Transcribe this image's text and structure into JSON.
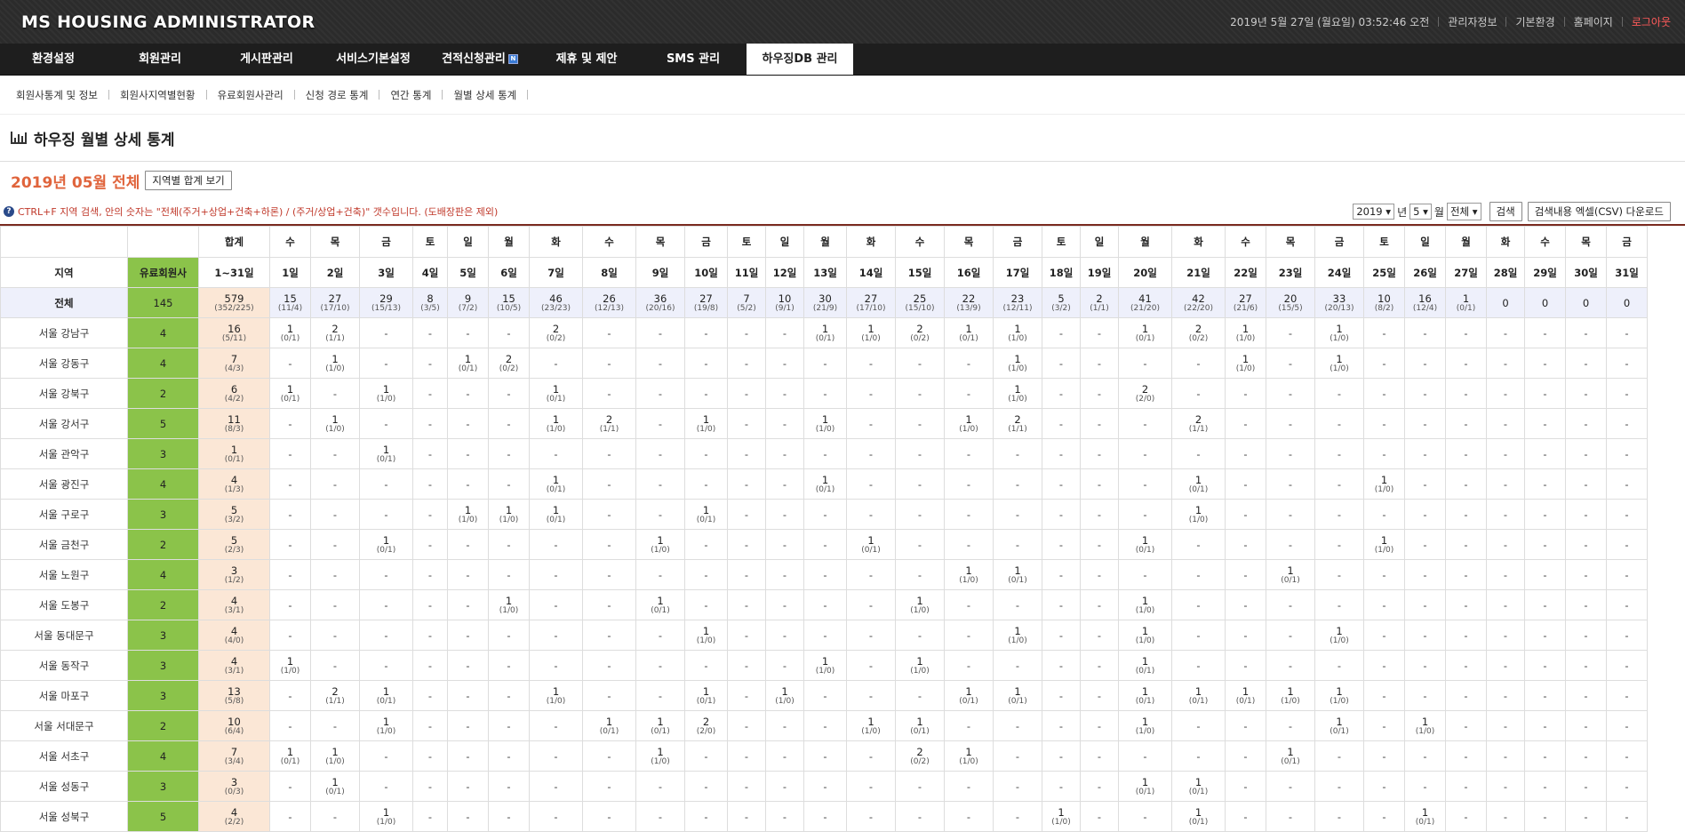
{
  "header": {
    "title": "MS HOUSING ADMINISTRATOR",
    "datetime": "2019년 5월 27일 (월요일) 03:52:46 오전",
    "links": [
      "관리자정보",
      "기본환경",
      "홈페이지",
      "로그아웃"
    ]
  },
  "nav": [
    "환경설정",
    "회원관리",
    "게시판관리",
    "서비스기본설정",
    "견적신청관리",
    "제휴 및 제안",
    "SMS 관리",
    "하우징DB 관리"
  ],
  "nav_badge": "N",
  "subnav": [
    "회원사통계 및 정보",
    "회원사지역별현황",
    "유료회원사관리",
    "신청 경로 통계",
    "연간 통계",
    "월별 상세 통계"
  ],
  "page_title": "하우징 월별 상세 통계",
  "period": {
    "title": "2019년 05월 전체",
    "region_sum_button": "지역별 합계 보기"
  },
  "note": "CTRL+F 지역 검색, 안의 숫자는 \"전체(주거+상업+건축+하론) / (주거/상업+건축)\" 갯수입니다. (도배장판은 제외)",
  "controls": {
    "year": "2019",
    "year_suffix": "년",
    "month": "5",
    "month_suffix": "월",
    "type": "전체",
    "search_button": "검색",
    "csv_button": "검색내용 엑셀(CSV) 다운로드"
  },
  "table": {
    "head_sum_dow": "합계",
    "head_region": "지역",
    "head_members": "유료회원사",
    "head_sum_range": "1~31일",
    "dow": [
      "수",
      "목",
      "금",
      "토",
      "일",
      "월",
      "화",
      "수",
      "목",
      "금",
      "토",
      "일",
      "월",
      "화",
      "수",
      "목",
      "금",
      "토",
      "일",
      "월",
      "화",
      "수",
      "목",
      "금",
      "토",
      "일",
      "월",
      "화",
      "수",
      "목",
      "금"
    ],
    "days": [
      "1일",
      "2일",
      "3일",
      "4일",
      "5일",
      "6일",
      "7일",
      "8일",
      "9일",
      "10일",
      "11일",
      "12일",
      "13일",
      "14일",
      "15일",
      "16일",
      "17일",
      "18일",
      "19일",
      "20일",
      "21일",
      "22일",
      "23일",
      "24일",
      "25일",
      "26일",
      "27일",
      "28일",
      "29일",
      "30일",
      "31일"
    ],
    "total": {
      "region": "전체",
      "members": "145",
      "sum_v": "579",
      "sum_s": "(352/225)",
      "cells": [
        [
          "15",
          "(11/4)"
        ],
        [
          "27",
          "(17/10)"
        ],
        [
          "29",
          "(15/13)"
        ],
        [
          "8",
          "(3/5)"
        ],
        [
          "9",
          "(7/2)"
        ],
        [
          "15",
          "(10/5)"
        ],
        [
          "46",
          "(23/23)"
        ],
        [
          "26",
          "(12/13)"
        ],
        [
          "36",
          "(20/16)"
        ],
        [
          "27",
          "(19/8)"
        ],
        [
          "7",
          "(5/2)"
        ],
        [
          "10",
          "(9/1)"
        ],
        [
          "30",
          "(21/9)"
        ],
        [
          "27",
          "(17/10)"
        ],
        [
          "25",
          "(15/10)"
        ],
        [
          "22",
          "(13/9)"
        ],
        [
          "23",
          "(12/11)"
        ],
        [
          "5",
          "(3/2)"
        ],
        [
          "2",
          "(1/1)"
        ],
        [
          "41",
          "(21/20)"
        ],
        [
          "42",
          "(22/20)"
        ],
        [
          "27",
          "(21/6)"
        ],
        [
          "20",
          "(15/5)"
        ],
        [
          "33",
          "(20/13)"
        ],
        [
          "10",
          "(8/2)"
        ],
        [
          "16",
          "(12/4)"
        ],
        [
          "1",
          "(0/1)"
        ],
        [
          "0",
          ""
        ],
        [
          "0",
          ""
        ],
        [
          "0",
          ""
        ],
        [
          "0",
          ""
        ]
      ]
    },
    "rows": [
      {
        "region": "서울 강남구",
        "members": "4",
        "sum_v": "16",
        "sum_s": "(5/11)",
        "cells": {
          "0": [
            "1",
            "(0/1)"
          ],
          "1": [
            "2",
            "(1/1)"
          ],
          "6": [
            "2",
            "(0/2)"
          ],
          "12": [
            "1",
            "(0/1)"
          ],
          "13": [
            "1",
            "(1/0)"
          ],
          "14": [
            "2",
            "(0/2)"
          ],
          "15": [
            "1",
            "(0/1)"
          ],
          "16": [
            "1",
            "(1/0)"
          ],
          "19": [
            "1",
            "(0/1)"
          ],
          "20": [
            "2",
            "(0/2)"
          ],
          "21": [
            "1",
            "(1/0)"
          ],
          "23": [
            "1",
            "(1/0)"
          ]
        }
      },
      {
        "region": "서울 강동구",
        "members": "4",
        "sum_v": "7",
        "sum_s": "(4/3)",
        "cells": {
          "1": [
            "1",
            "(1/0)"
          ],
          "4": [
            "1",
            "(0/1)"
          ],
          "5": [
            "2",
            "(0/2)"
          ],
          "16": [
            "1",
            "(1/0)"
          ],
          "21": [
            "1",
            "(1/0)"
          ],
          "23": [
            "1",
            "(1/0)"
          ]
        }
      },
      {
        "region": "서울 강북구",
        "members": "2",
        "sum_v": "6",
        "sum_s": "(4/2)",
        "cells": {
          "0": [
            "1",
            "(0/1)"
          ],
          "2": [
            "1",
            "(1/0)"
          ],
          "6": [
            "1",
            "(0/1)"
          ],
          "16": [
            "1",
            "(1/0)"
          ],
          "19": [
            "2",
            "(2/0)"
          ]
        }
      },
      {
        "region": "서울 강서구",
        "members": "5",
        "sum_v": "11",
        "sum_s": "(8/3)",
        "cells": {
          "1": [
            "1",
            "(1/0)"
          ],
          "6": [
            "1",
            "(1/0)"
          ],
          "7": [
            "2",
            "(1/1)"
          ],
          "9": [
            "1",
            "(1/0)"
          ],
          "12": [
            "1",
            "(1/0)"
          ],
          "15": [
            "1",
            "(1/0)"
          ],
          "16": [
            "2",
            "(1/1)"
          ],
          "20": [
            "2",
            "(1/1)"
          ]
        }
      },
      {
        "region": "서울 관악구",
        "members": "3",
        "sum_v": "1",
        "sum_s": "(0/1)",
        "cells": {
          "2": [
            "1",
            "(0/1)"
          ]
        }
      },
      {
        "region": "서울 광진구",
        "members": "4",
        "sum_v": "4",
        "sum_s": "(1/3)",
        "cells": {
          "6": [
            "1",
            "(0/1)"
          ],
          "12": [
            "1",
            "(0/1)"
          ],
          "20": [
            "1",
            "(0/1)"
          ],
          "24": [
            "1",
            "(1/0)"
          ]
        }
      },
      {
        "region": "서울 구로구",
        "members": "3",
        "sum_v": "5",
        "sum_s": "(3/2)",
        "cells": {
          "4": [
            "1",
            "(1/0)"
          ],
          "5": [
            "1",
            "(1/0)"
          ],
          "6": [
            "1",
            "(0/1)"
          ],
          "9": [
            "1",
            "(0/1)"
          ],
          "20": [
            "1",
            "(1/0)"
          ]
        }
      },
      {
        "region": "서울 금천구",
        "members": "2",
        "sum_v": "5",
        "sum_s": "(2/3)",
        "cells": {
          "2": [
            "1",
            "(0/1)"
          ],
          "8": [
            "1",
            "(1/0)"
          ],
          "13": [
            "1",
            "(0/1)"
          ],
          "19": [
            "1",
            "(0/1)"
          ],
          "24": [
            "1",
            "(1/0)"
          ]
        }
      },
      {
        "region": "서울 노원구",
        "members": "4",
        "sum_v": "3",
        "sum_s": "(1/2)",
        "cells": {
          "15": [
            "1",
            "(1/0)"
          ],
          "16": [
            "1",
            "(0/1)"
          ],
          "22": [
            "1",
            "(0/1)"
          ]
        }
      },
      {
        "region": "서울 도봉구",
        "members": "2",
        "sum_v": "4",
        "sum_s": "(3/1)",
        "cells": {
          "5": [
            "1",
            "(1/0)"
          ],
          "8": [
            "1",
            "(0/1)"
          ],
          "14": [
            "1",
            "(1/0)"
          ],
          "19": [
            "1",
            "(1/0)"
          ]
        }
      },
      {
        "region": "서울 동대문구",
        "members": "3",
        "sum_v": "4",
        "sum_s": "(4/0)",
        "cells": {
          "9": [
            "1",
            "(1/0)"
          ],
          "16": [
            "1",
            "(1/0)"
          ],
          "19": [
            "1",
            "(1/0)"
          ],
          "23": [
            "1",
            "(1/0)"
          ]
        }
      },
      {
        "region": "서울 동작구",
        "members": "3",
        "sum_v": "4",
        "sum_s": "(3/1)",
        "cells": {
          "0": [
            "1",
            "(1/0)"
          ],
          "12": [
            "1",
            "(1/0)"
          ],
          "14": [
            "1",
            "(1/0)"
          ],
          "19": [
            "1",
            "(0/1)"
          ]
        }
      },
      {
        "region": "서울 마포구",
        "members": "3",
        "sum_v": "13",
        "sum_s": "(5/8)",
        "cells": {
          "1": [
            "2",
            "(1/1)"
          ],
          "2": [
            "1",
            "(0/1)"
          ],
          "6": [
            "1",
            "(1/0)"
          ],
          "9": [
            "1",
            "(0/1)"
          ],
          "11": [
            "1",
            "(1/0)"
          ],
          "15": [
            "1",
            "(0/1)"
          ],
          "16": [
            "1",
            "(0/1)"
          ],
          "19": [
            "1",
            "(0/1)"
          ],
          "20": [
            "1",
            "(0/1)"
          ],
          "21": [
            "1",
            "(0/1)"
          ],
          "22": [
            "1",
            "(1/0)"
          ],
          "23": [
            "1",
            "(1/0)"
          ]
        }
      },
      {
        "region": "서울 서대문구",
        "members": "2",
        "sum_v": "10",
        "sum_s": "(6/4)",
        "cells": {
          "2": [
            "1",
            "(1/0)"
          ],
          "7": [
            "1",
            "(0/1)"
          ],
          "8": [
            "1",
            "(0/1)"
          ],
          "9": [
            "2",
            "(2/0)"
          ],
          "13": [
            "1",
            "(1/0)"
          ],
          "14": [
            "1",
            "(0/1)"
          ],
          "19": [
            "1",
            "(1/0)"
          ],
          "23": [
            "1",
            "(0/1)"
          ],
          "25": [
            "1",
            "(1/0)"
          ]
        }
      },
      {
        "region": "서울 서초구",
        "members": "4",
        "sum_v": "7",
        "sum_s": "(3/4)",
        "cells": {
          "0": [
            "1",
            "(0/1)"
          ],
          "1": [
            "1",
            "(1/0)"
          ],
          "8": [
            "1",
            "(1/0)"
          ],
          "14": [
            "2",
            "(0/2)"
          ],
          "15": [
            "1",
            "(1/0)"
          ],
          "22": [
            "1",
            "(0/1)"
          ]
        }
      },
      {
        "region": "서울 성동구",
        "members": "3",
        "sum_v": "3",
        "sum_s": "(0/3)",
        "cells": {
          "1": [
            "1",
            "(0/1)"
          ],
          "19": [
            "1",
            "(0/1)"
          ],
          "20": [
            "1",
            "(0/1)"
          ]
        }
      },
      {
        "region": "서울 성북구",
        "members": "5",
        "sum_v": "4",
        "sum_s": "(2/2)",
        "cells": {
          "2": [
            "1",
            "(1/0)"
          ],
          "17": [
            "1",
            "(1/0)"
          ],
          "20": [
            "1",
            "(0/1)"
          ],
          "25": [
            "1",
            "(0/1)"
          ]
        }
      }
    ]
  }
}
